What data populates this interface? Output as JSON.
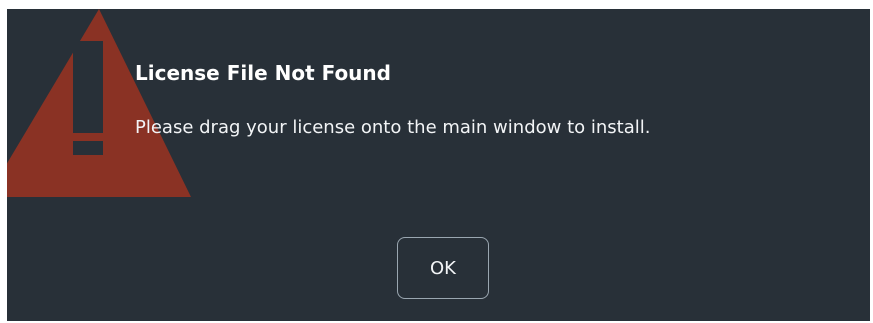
{
  "dialog": {
    "title": "License File Not Found",
    "message": "Please drag your license onto the main window to install.",
    "ok_label": "OK",
    "icon": "warning-triangle-icon",
    "colors": {
      "background": "#283038",
      "warning": "#8f3323",
      "text": "#ffffff",
      "button_border": "#9aa6b0"
    }
  }
}
